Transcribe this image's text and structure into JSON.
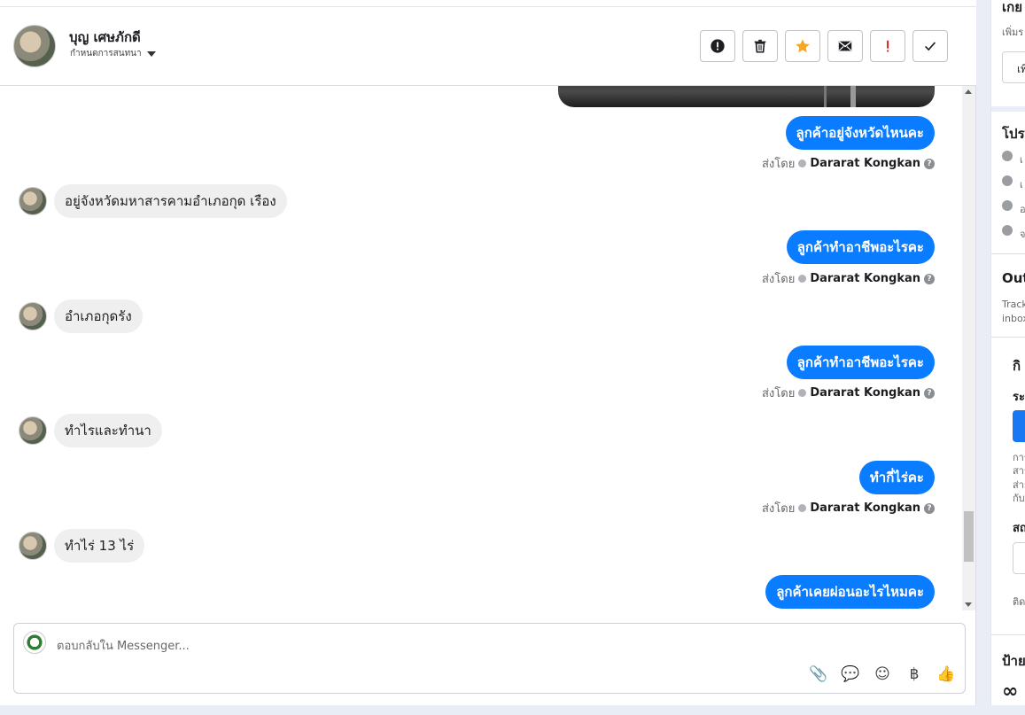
{
  "conversation": {
    "contact_name": "บุญ เศษภักดี",
    "assign_label": "กำหนดการสนทนา"
  },
  "actions": [
    {
      "name": "mark-spam-button",
      "icon": "exclamation-circle-icon"
    },
    {
      "name": "delete-button",
      "icon": "trash-icon"
    },
    {
      "name": "star-button",
      "icon": "star-icon",
      "color": "#f5a623"
    },
    {
      "name": "mark-unread-button",
      "icon": "envelope-icon"
    },
    {
      "name": "follow-up-button",
      "icon": "exclamation-icon",
      "color": "#e02424"
    },
    {
      "name": "mark-done-button",
      "icon": "checkmark-icon"
    }
  ],
  "messages": {
    "sent_prefix": "ส่งโดย",
    "agent": "Dararat Kongkan",
    "m1": "ลูกค้าอยู่จังหวัดไหนคะ",
    "m2": "อยู่จังหวัดมหาสารคามอำเภอกุด เรือง",
    "m3": "ลูกค้าทำอาชีพอะไรคะ",
    "m4": "อำเภอกุดรัง",
    "m5": "ลูกค้าทำอาชีพอะไรคะ",
    "m6": "ทำไรและทำนา",
    "m7": "ทำกี่ไร่คะ",
    "m8": "ทำไร่ 13 ไร่",
    "m9": "ลูกค้าเคยผ่อนอะไรไหมคะ"
  },
  "composer": {
    "placeholder": "ตอบกลับใน Messenger...",
    "tools": [
      {
        "name": "attach-icon",
        "glyph": "📎"
      },
      {
        "name": "saved-reply-icon",
        "glyph": "💬"
      },
      {
        "name": "emoji-icon",
        "glyph": "☺"
      },
      {
        "name": "baht-icon",
        "glyph": "฿"
      },
      {
        "name": "like-icon",
        "glyph": "👍"
      }
    ]
  },
  "side_panel": {
    "s1_title": "เกย",
    "s1_sub": "เพิ่มร",
    "s1_btn": "เพิ",
    "s2_title": "โปร",
    "s2_items": [
      "เ",
      "เ",
      "อ",
      "จ"
    ],
    "s3_title": "Out",
    "s3_sub1": "Track",
    "s3_sub2": "inbox",
    "s4_title": "กิ",
    "s4_sub": "ระ",
    "s4_p1": "การ",
    "s4_p2": "สาร",
    "s4_p3": "ส่าก",
    "s4_p4": "กับ",
    "s5_title": "สถ",
    "s5_foot": "ติด",
    "s6_title": "ป้าย",
    "s6_logo": "∞"
  }
}
